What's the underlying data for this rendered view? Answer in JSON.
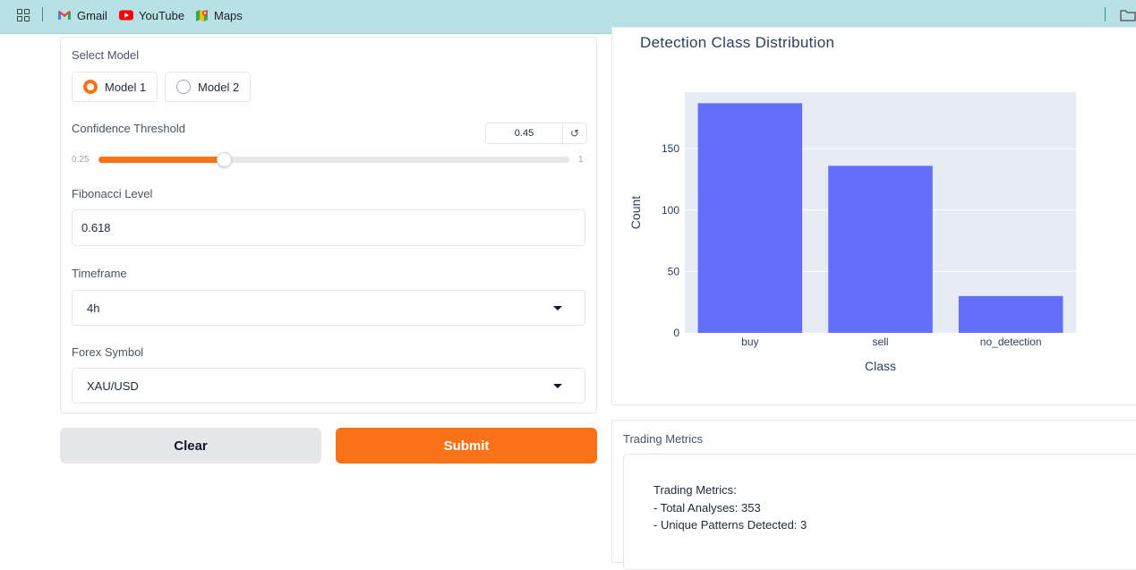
{
  "bookmarks": {
    "items": [
      {
        "label": "Gmail",
        "icon": "gmail-icon"
      },
      {
        "label": "YouTube",
        "icon": "youtube-icon"
      },
      {
        "label": "Maps",
        "icon": "maps-icon"
      }
    ]
  },
  "form": {
    "model": {
      "label": "Select Model",
      "options": [
        "Model 1",
        "Model 2"
      ],
      "selected": "Model 1"
    },
    "confidence": {
      "label": "Confidence Threshold",
      "value": "0.45",
      "min_label": "0.25",
      "max_label": "1",
      "min": 0.25,
      "max": 1,
      "current": 0.45,
      "reset_icon": "reset-icon"
    },
    "fibonacci": {
      "label": "Fibonacci Level",
      "value": "0.618"
    },
    "timeframe": {
      "label": "Timeframe",
      "value": "4h"
    },
    "symbol": {
      "label": "Forex Symbol",
      "value": "XAU/USD"
    }
  },
  "buttons": {
    "clear": "Clear",
    "submit": "Submit"
  },
  "chart_data": {
    "type": "bar",
    "title": "Detection Class Distribution",
    "categories": [
      "buy",
      "sell",
      "no_detection"
    ],
    "values": [
      187,
      136,
      30
    ],
    "xlabel": "Class",
    "ylabel": "Count",
    "ylim": [
      0,
      196
    ],
    "yticks": [
      0,
      50,
      100,
      150
    ],
    "bar_color": "#636efa",
    "plot_bg": "#e5ecf6",
    "grid": true
  },
  "metrics": {
    "panel_label": "Trading Metrics",
    "lines": [
      "Trading Metrics:",
      "- Total Analyses: 353",
      "- Unique Patterns Detected: 3"
    ]
  },
  "colors": {
    "accent": "#f97316",
    "bookmark_bar": "#b7e1e4"
  }
}
